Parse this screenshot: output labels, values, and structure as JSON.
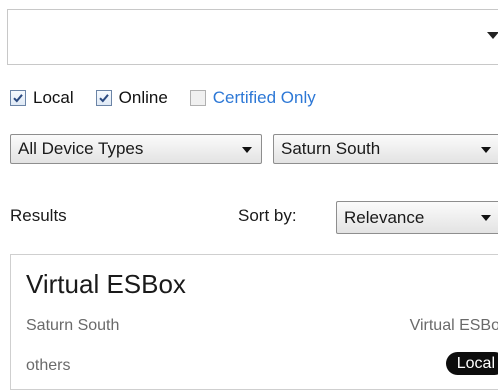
{
  "search": {
    "value": ""
  },
  "filters": {
    "local": {
      "label": "Local",
      "checked": true
    },
    "online": {
      "label": "Online",
      "checked": true
    },
    "certified": {
      "label": "Certified Only",
      "checked": false
    }
  },
  "dropdowns": {
    "device_type": "All Device Types",
    "location": "Saturn South"
  },
  "results_header": {
    "results_label": "Results",
    "sort_label": "Sort by:",
    "sort_value": "Relevance"
  },
  "results": [
    {
      "title": "Virtual ESBox",
      "location": "Saturn South",
      "type": "Virtual ESBox",
      "owner": "others",
      "badge": "Local"
    }
  ],
  "colors": {
    "link": "#2d78d6",
    "badge_bg": "#0d0d0d",
    "secondary_text": "#6a6a6a"
  },
  "icons": {
    "dropdown_arrow": "chevron-down-icon",
    "checkbox_check": "check-icon"
  }
}
